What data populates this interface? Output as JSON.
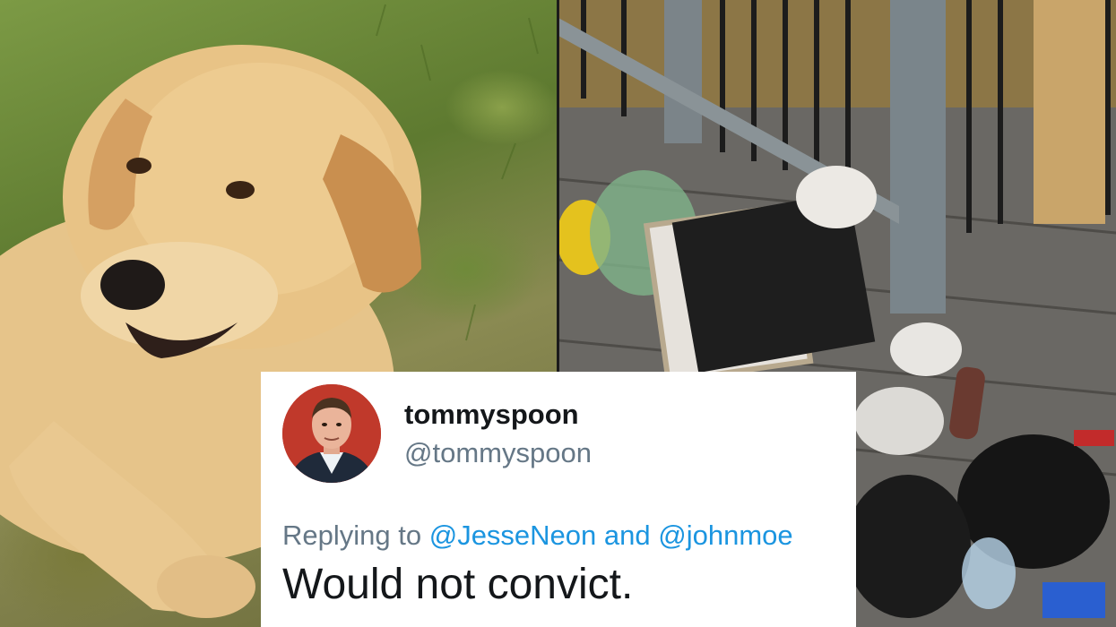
{
  "tweet": {
    "display_name": "tommyspoon",
    "handle": "@tommyspoon",
    "reply_prefix": "Replying to",
    "reply_mention_1": "@JesseNeon",
    "reply_and": "and",
    "reply_mention_2": "@johnmoe",
    "text": "Would not convict."
  },
  "colors": {
    "mention": "#1b95e0",
    "secondary_text": "#657786",
    "primary_text": "#14171a",
    "avatar_bg": "#c0392b"
  }
}
